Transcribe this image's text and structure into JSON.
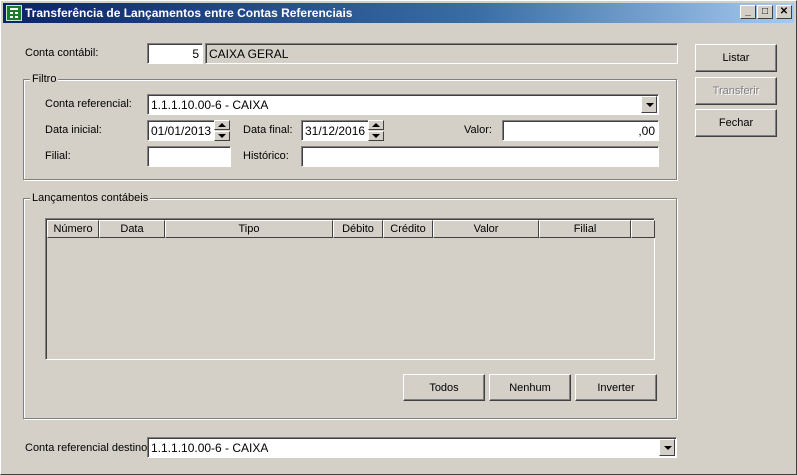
{
  "window": {
    "title": "Transferência de Lançamentos entre Contas Referenciais",
    "minimize": "_",
    "maximize": "□",
    "close": "✕"
  },
  "conta_contabil": {
    "label": "Conta contábil:",
    "codigo": "5",
    "descricao": "CAIXA GERAL"
  },
  "filtro": {
    "title": "Filtro",
    "conta_referencial_label": "Conta referencial:",
    "conta_referencial_value": "1.1.1.10.00-6 - CAIXA",
    "data_inicial_label": "Data inicial:",
    "data_inicial_value": "01/01/2013",
    "data_final_label": "Data final:",
    "data_final_value": "31/12/2016",
    "valor_label": "Valor:",
    "valor_value": ",00",
    "filial_label": "Filial:",
    "filial_value": "",
    "historico_label": "Histórico:",
    "historico_value": ""
  },
  "lancamentos": {
    "title": "Lançamentos contábeis",
    "columns": [
      "Número",
      "Data",
      "Tipo",
      "Débito",
      "Crédito",
      "Valor",
      "Filial",
      ""
    ],
    "rows": [],
    "todos": "Todos",
    "nenhum": "Nenhum",
    "inverter": "Inverter"
  },
  "destino": {
    "label": "Conta referencial destino:",
    "value": "1.1.1.10.00-6 - CAIXA"
  },
  "actions": {
    "listar": "Listar",
    "transferir": "Transferir",
    "fechar": "Fechar"
  },
  "colors": {
    "face": "#d4d0c8",
    "title_start": "#0a246a",
    "title_end": "#a6caf0"
  },
  "icons": {
    "app": "calculator-icon",
    "dropdown": "chevron-down-icon",
    "spin_up": "spin-up-icon",
    "spin_down": "spin-down-icon"
  }
}
